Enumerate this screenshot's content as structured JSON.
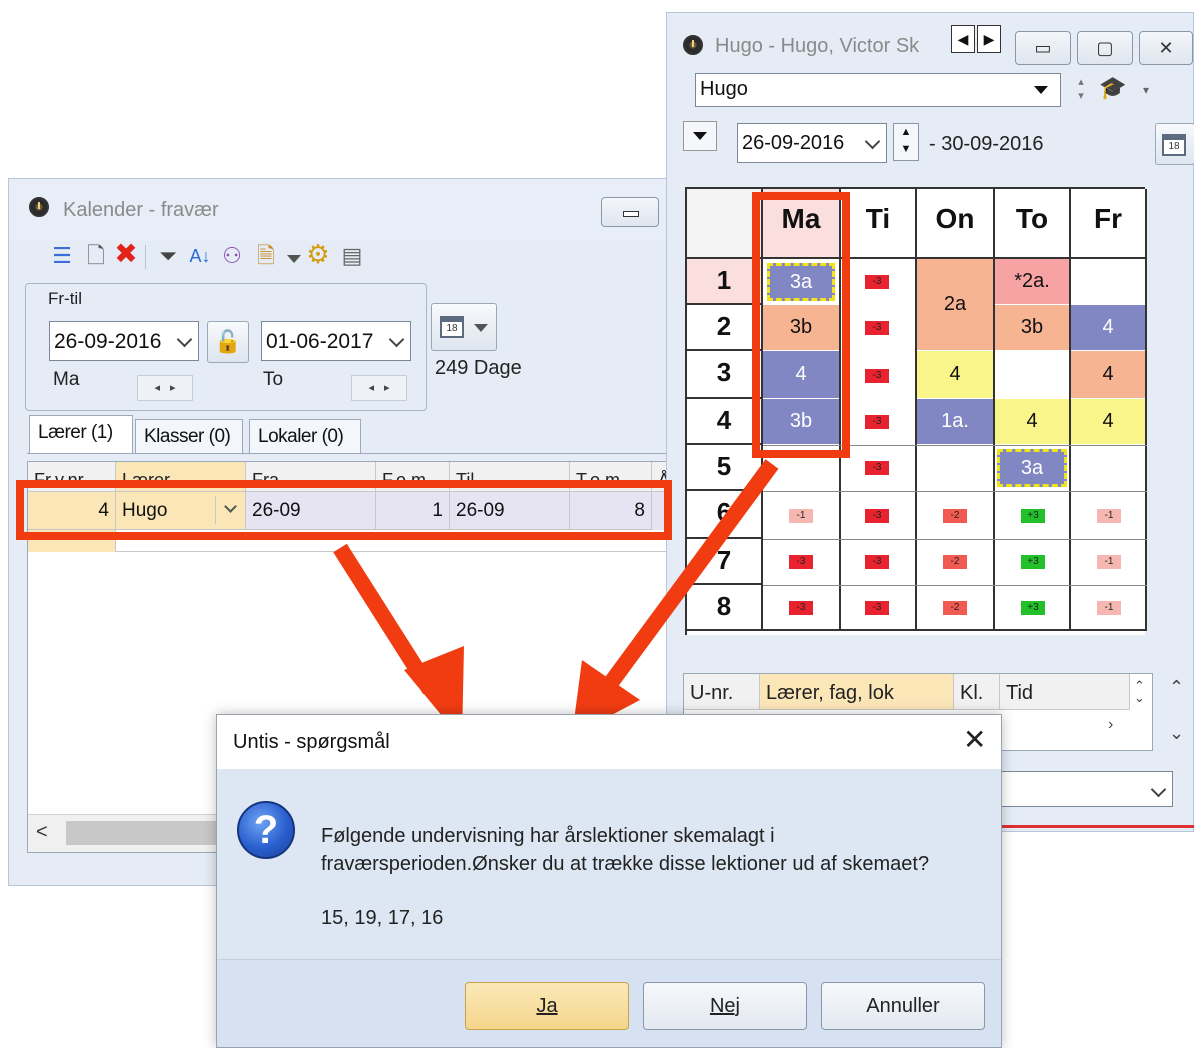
{
  "kalender": {
    "title": "Kalender - fravær",
    "group_legend": "Fr-til",
    "from_date": "26-09-2016",
    "from_day": "Ma",
    "to_date": "01-06-2017",
    "to_day": "To",
    "days_count": "249 Dage",
    "tabs": [
      "Lærer (1)",
      "Klasser (0)",
      "Lokaler (0)"
    ],
    "columns": [
      "Fr.v.nr.",
      "Lærer",
      "Fra",
      "F.o.m.",
      "Til",
      "T.o.m.",
      "Å"
    ],
    "row": {
      "nr": "4",
      "teacher": "Hugo",
      "from": "26-09",
      "from_period": "1",
      "to": "26-09",
      "to_period": "8"
    },
    "scroll_left": "<"
  },
  "hugo": {
    "title": "Hugo - Hugo, Victor Sk",
    "selector_value": "Hugo",
    "week_start": "26-09-2016",
    "week_end": "- 30-09-2016",
    "calendar_day": "18",
    "days": [
      "Ma",
      "Ti",
      "On",
      "To",
      "Fr"
    ],
    "periods": [
      "1",
      "2",
      "3",
      "4",
      "5",
      "6",
      "7",
      "8"
    ],
    "lessons": {
      "ma1": "3a",
      "ma2": "3b",
      "ma3": "4",
      "ma4": "3b",
      "on12": "2a",
      "on3": "4",
      "on4": "1a.",
      "to1": "*2a.",
      "to2": "3b",
      "to4": "4",
      "to5": "3a",
      "fr2": "4",
      "fr3": "4",
      "fr4": "4"
    },
    "badges": {
      "m3": "-3",
      "m2": "-2",
      "m1": "-1",
      "p3": "+3"
    },
    "bottom_cols": [
      "U-nr.",
      "Lærer, fag, lok",
      "Kl.",
      "Tid"
    ]
  },
  "dialog": {
    "title": "Untis - spørgsmål",
    "line1": "Følgende undervisning har årslektioner skemalagt i",
    "line2": "fraværsperioden.Ønsker du at trække disse lektioner ud af skemaet?",
    "numbers": "15, 19, 17, 16",
    "btn_yes": "Ja",
    "btn_no": "Nej",
    "btn_cancel": "Annuller"
  },
  "colors": {
    "annotation": "#f13c12",
    "lesson_purple": "#8187c2",
    "lesson_salmon": "#f6b493",
    "lesson_yellow": "#f9f58a",
    "lesson_pink": "#f7a3a3"
  }
}
